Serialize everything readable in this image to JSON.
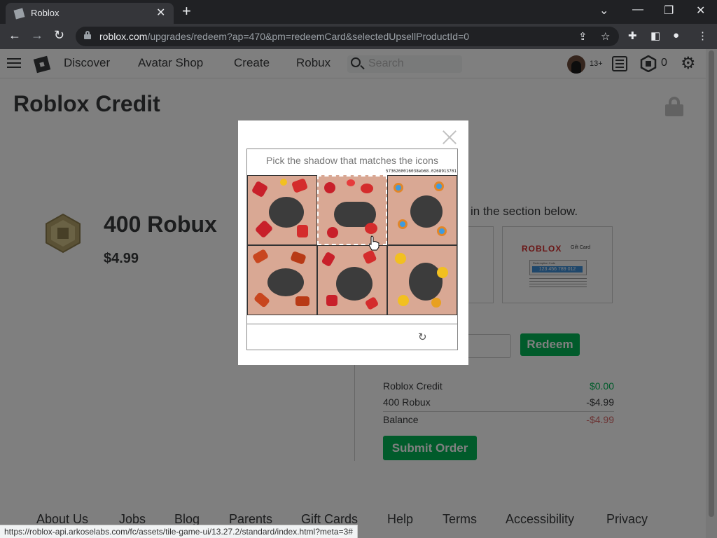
{
  "browser": {
    "tab_title": "Roblox",
    "url_domain": "roblox.com",
    "url_path": "/upgrades/redeem?ap=470&pm=redeemCard&selectedUpsellProductId=0",
    "status_url": "https://roblox-api.arkoselabs.com/fc/assets/tile-game-ui/13.27.2/standard/index.html?meta=3#"
  },
  "header": {
    "nav": [
      "Discover",
      "Avatar Shop",
      "Create",
      "Robux"
    ],
    "search_placeholder": "Search",
    "age_badge": "13+",
    "robux_count": "0"
  },
  "page": {
    "title": "Roblox Credit",
    "product_name": "400 Robux",
    "product_price": "$4.99",
    "instruction": "in the section below.",
    "giftcard": {
      "brand": "ROBLOX",
      "subtitle": "Gift Card",
      "code_label": "Redemption Code",
      "code": "123 456 789 012"
    },
    "redeem_label": "Redeem",
    "summary": [
      {
        "label": "Roblox Credit",
        "amount": "$0.00"
      },
      {
        "label": "400 Robux",
        "amount": "-$4.99"
      },
      {
        "label": "Balance",
        "amount": "-$4.99"
      }
    ],
    "submit_label": "Submit Order"
  },
  "footer": [
    "About Us",
    "Jobs",
    "Blog",
    "Parents",
    "Gift Cards",
    "Help",
    "Terms",
    "Accessibility",
    "Privacy"
  ],
  "captcha": {
    "prompt": "Pick the shadow that matches the icons",
    "token": "5736260016038eb68.0268913701",
    "selected_tile": 2
  },
  "colors": {
    "accent_green": "#02b757",
    "negative_red": "#d86868",
    "text_dark": "#393b3d"
  }
}
